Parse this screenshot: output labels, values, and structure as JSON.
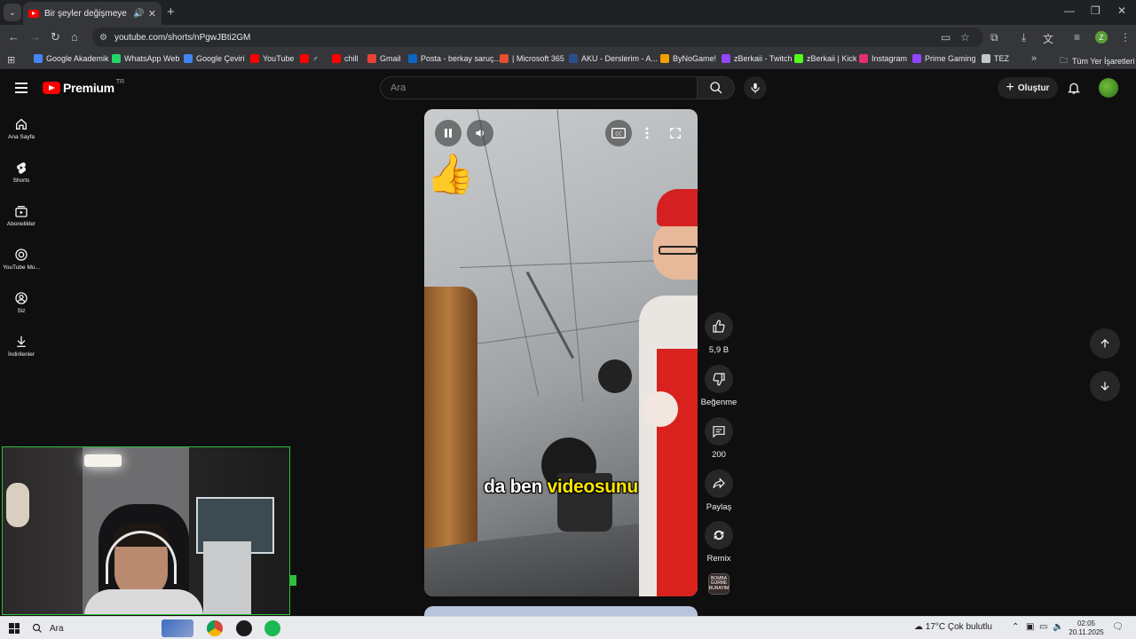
{
  "browser": {
    "tab_title": "Bir şeyler değişmeye başladı",
    "url": "youtube.com/shorts/nPgwJBti2GM",
    "bookmarks": [
      {
        "label": "Google Akademik",
        "color": "#4285f4"
      },
      {
        "label": "WhatsApp Web",
        "color": "#25d366"
      },
      {
        "label": "Google Çeviri",
        "color": "#4285f4"
      },
      {
        "label": "YouTube",
        "color": "#ff0000"
      },
      {
        "label": "♂",
        "color": "#ff0000"
      },
      {
        "label": "chill",
        "color": "#ff0000"
      },
      {
        "label": "Gmail",
        "color": "#ea4335"
      },
      {
        "label": "Posta - berkay saruç...",
        "color": "#0a66c2"
      },
      {
        "label": "| Microsoft 365",
        "color": "#e54e2f"
      },
      {
        "label": "AKU - Derslerim - A...",
        "color": "#2b4f8a"
      },
      {
        "label": "ByNoGame!",
        "color": "#f2a100"
      },
      {
        "label": "zBerkaii - Twitch",
        "color": "#9146ff"
      },
      {
        "label": "zBerkaii | Kick",
        "color": "#53fc18"
      },
      {
        "label": "Instagram",
        "color": "#e1306c"
      },
      {
        "label": "Prime Gaming",
        "color": "#9146ff"
      },
      {
        "label": "TEZ",
        "color": "#c4c7c5"
      }
    ],
    "all_bookmarks_label": "Tüm Yer İşaretleri",
    "profile_initial": "Z"
  },
  "youtube": {
    "logo_text": "Premium",
    "logo_country": "TR",
    "search_placeholder": "Ara",
    "create_label": "Oluştur",
    "sidebar": [
      {
        "label": "Ana Sayfa",
        "icon": "home-icon"
      },
      {
        "label": "Shorts",
        "icon": "shorts-icon"
      },
      {
        "label": "Abonelikler",
        "icon": "subscriptions-icon"
      },
      {
        "label": "YouTube Mu...",
        "icon": "youtube-music-icon"
      },
      {
        "label": "Siz",
        "icon": "you-icon"
      },
      {
        "label": "İndirilenler",
        "icon": "download-icon"
      }
    ],
    "video": {
      "caption_prefix": "da ben ",
      "caption_highlight": "videosunu"
    },
    "actions": {
      "like_count": "5,9 B",
      "dislike_label": "Beğenme",
      "comment_count": "200",
      "share_label": "Paylaş",
      "remix_label": "Remix",
      "channel_badge": "BOMBA GURME BURAYIM"
    }
  },
  "taskbar": {
    "search_label": "Ara",
    "weather": "17°C  Çok bulutlu",
    "time": "02:05",
    "date": "20.11.2025"
  }
}
